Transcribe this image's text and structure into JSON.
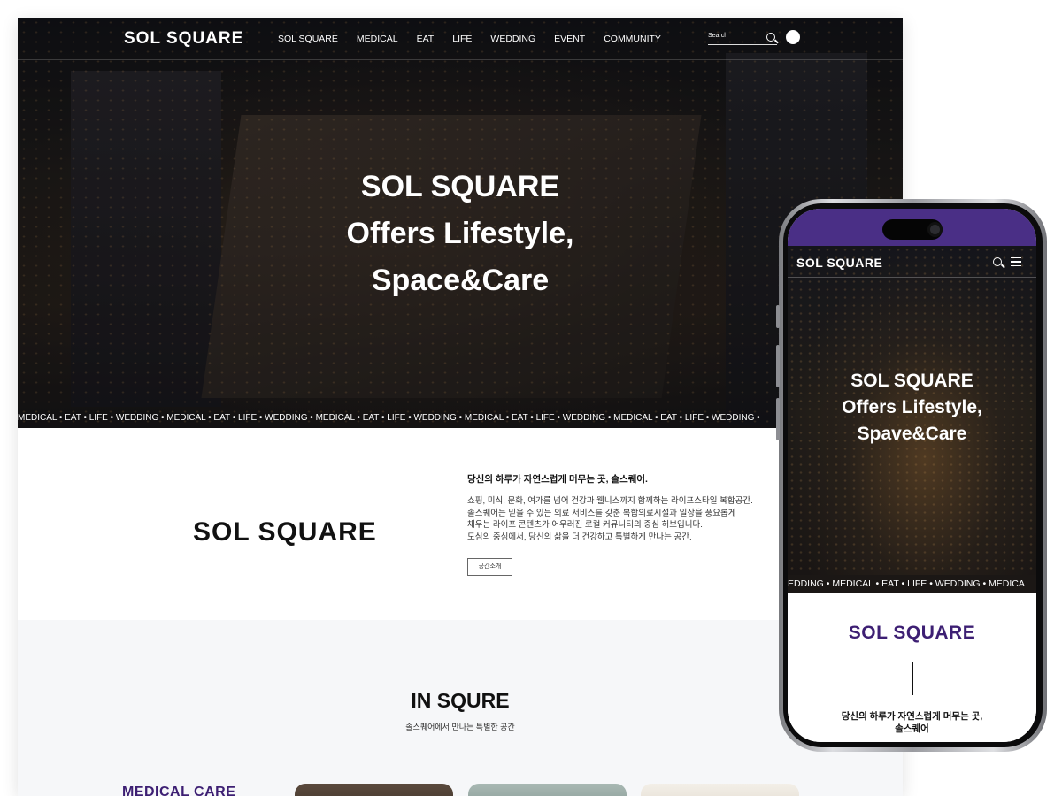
{
  "desktop": {
    "nav": {
      "logo": "SOL SQUARE",
      "items": [
        "SOL SQUARE",
        "MEDICAL",
        "EAT",
        "LIFE",
        "WEDDING",
        "EVENT",
        "COMMUNITY"
      ],
      "search_placeholder": "Search"
    },
    "hero": {
      "title_line1": "SOL SQUARE",
      "title_line2": "Offers Lifestyle,",
      "title_line3": "Space&Care",
      "ticker": "MEDICAL • EAT • LIFE • WEDDING • MEDICAL • EAT • LIFE • WEDDING • MEDICAL • EAT • LIFE • WEDDING • MEDICAL • EAT • LIFE • WEDDING • MEDICAL • EAT • LIFE • WEDDING •"
    },
    "intro": {
      "logo": "SOL SQUARE",
      "headline": "당신의 하루가 자연스럽게 머무는 곳, 솔스퀘어.",
      "body": [
        "쇼핑, 미식, 문화, 여가를 넘어 건강과 웰니스까지 함께하는 라이프스타일 복합공간.",
        "솔스퀘어는 믿을 수 있는 의료 서비스를 갖춘 복합의료시설과 일상을 풍요롭게",
        "채우는 라이프 콘텐츠가 어우러진 로컬 커뮤니티의 중심 허브입니다.",
        "도심의 중심에서, 당신의 삶을 더 건강하고 특별하게 만나는 공간."
      ],
      "button": "공간소개"
    },
    "in_square": {
      "title": "IN SQURE",
      "subtitle": "솔스퀘어에서 만나는 특별한 공간",
      "category": "MEDICAL CARE"
    }
  },
  "mobile": {
    "nav": {
      "logo": "SOL SQUARE"
    },
    "hero": {
      "title_line1": "SOL SQUARE",
      "title_line2": "Offers Lifestyle,",
      "title_line3": "Spave&Care",
      "ticker": "EDDING • MEDICAL • EAT • LIFE • WEDDING • MEDICA"
    },
    "content": {
      "logo": "SOL SQUARE",
      "text_line1": "당신의 하루가 자연스럽게 머무는 곳,",
      "text_line2": "솔스퀘어"
    }
  },
  "colors": {
    "brand_purple": "#3d1f73",
    "status_bar_purple": "#4a2f86"
  }
}
